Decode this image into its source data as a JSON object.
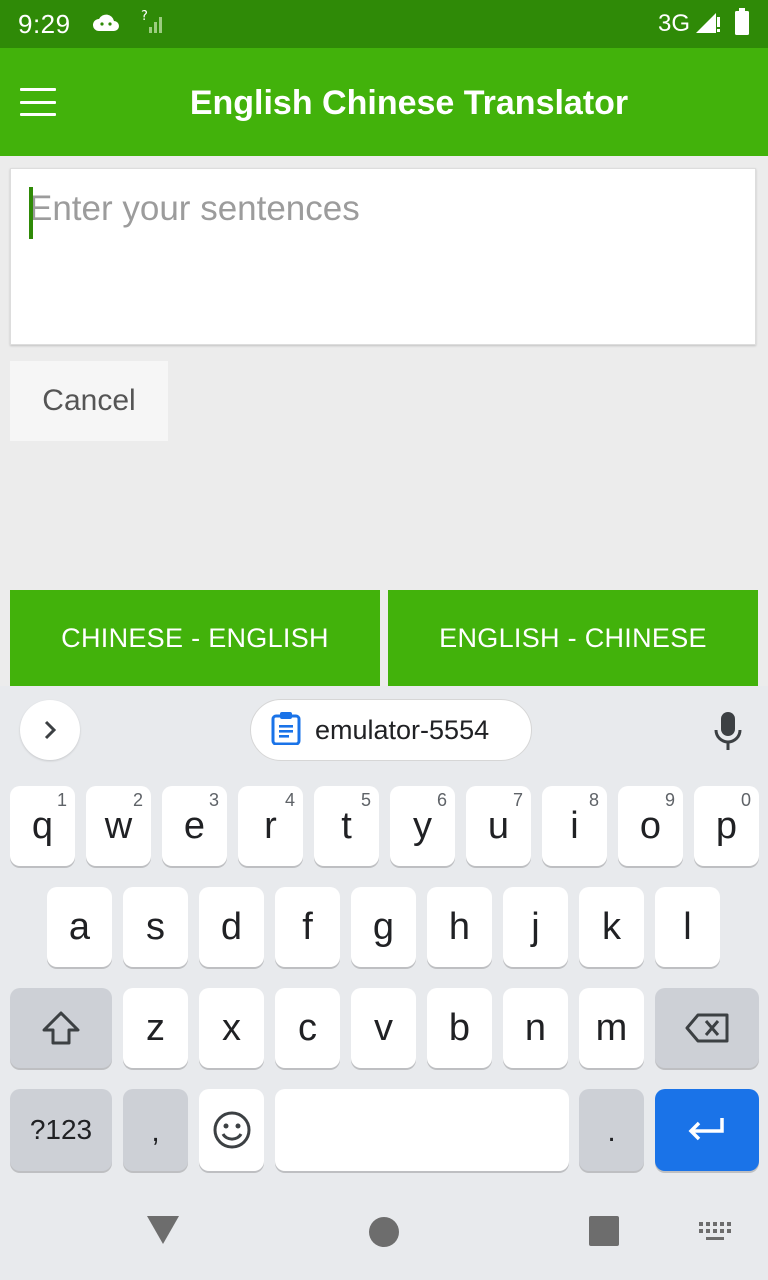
{
  "status_bar": {
    "time": "9:29",
    "network": "3G",
    "icons": [
      "cloud-icon",
      "no-signal-icon",
      "signal-icon",
      "battery-icon"
    ]
  },
  "app_bar": {
    "title": "English Chinese Translator",
    "menu_icon": "hamburger-menu-icon"
  },
  "input": {
    "placeholder": "Enter your sentences",
    "value": ""
  },
  "buttons": {
    "cancel": "Cancel",
    "chinese_english": "CHINESE - ENGLISH",
    "english_chinese": "ENGLISH - CHINESE"
  },
  "keyboard": {
    "clipboard_chip": "emulator-5554",
    "row1": [
      {
        "key": "q",
        "hint": "1"
      },
      {
        "key": "w",
        "hint": "2"
      },
      {
        "key": "e",
        "hint": "3"
      },
      {
        "key": "r",
        "hint": "4"
      },
      {
        "key": "t",
        "hint": "5"
      },
      {
        "key": "y",
        "hint": "6"
      },
      {
        "key": "u",
        "hint": "7"
      },
      {
        "key": "i",
        "hint": "8"
      },
      {
        "key": "o",
        "hint": "9"
      },
      {
        "key": "p",
        "hint": "0"
      }
    ],
    "row2": [
      "a",
      "s",
      "d",
      "f",
      "g",
      "h",
      "j",
      "k",
      "l"
    ],
    "row3": [
      "z",
      "x",
      "c",
      "v",
      "b",
      "n",
      "m"
    ],
    "symbols_key": "?123",
    "comma_key": ",",
    "period_key": ".",
    "accent_color": "#1a73e8"
  },
  "colors": {
    "status_bar": "#2f8a07",
    "app_bar": "#42b20b",
    "background": "#ececec"
  }
}
